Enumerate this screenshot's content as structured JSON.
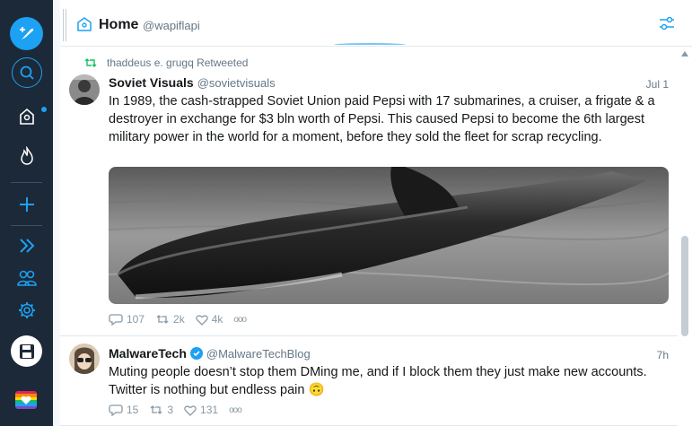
{
  "column": {
    "index": "1",
    "title": "Home",
    "handle": "@wapiflapi"
  },
  "tweets": [
    {
      "retweet_label": "thaddeus e. grugq Retweeted",
      "name": "Soviet Visuals",
      "handle": "@sovietvisuals",
      "time": "Jul 1",
      "text": "In 1989, the cash-strapped Soviet Union paid Pepsi with 17 submarines, a cruiser, a frigate & a destroyer in exchange for $3 bln worth of Pepsi. This caused Pepsi to become the 6th largest military power in the world for a moment, before they sold the fleet for scrap recycling.",
      "replies": "107",
      "retweets": "2k",
      "likes": "4k",
      "more": "ooo"
    },
    {
      "name": "MalwareTech",
      "handle": "@MalwareTechBlog",
      "time": "7h",
      "text": "Muting people doesn’t stop them DMing me, and if I block them they just make new accounts. Twitter is nothing but endless pain 🙃",
      "replies": "15",
      "retweets": "3",
      "likes": "131",
      "more": "ooo"
    }
  ],
  "colors": {
    "rail": "#1c2938",
    "accent": "#1da1f2",
    "retweet_green": "#17bf63",
    "muted": "#657786"
  }
}
